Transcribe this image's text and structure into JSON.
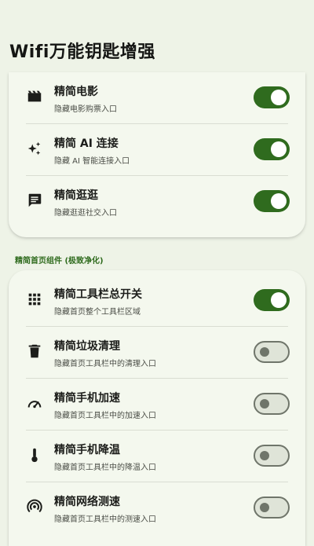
{
  "header": {
    "title": "Wifi万能钥匙增强"
  },
  "group1": [
    {
      "title": "精简电影",
      "subtitle": "隐藏电影购票入口",
      "icon": "clapperboard-icon",
      "enabled": true
    },
    {
      "title": "精简 AI 连接",
      "subtitle": "隐藏 AI 智能连接入口",
      "icon": "sparkle-icon",
      "enabled": true
    },
    {
      "title": "精简逛逛",
      "subtitle": "隐藏逛逛社交入口",
      "icon": "chat-message-icon",
      "enabled": true
    }
  ],
  "section2": {
    "label": "精简首页组件 (极致净化)"
  },
  "group2": [
    {
      "title": "精简工具栏总开关",
      "subtitle": "隐藏首页整个工具栏区域",
      "icon": "grid-dots-icon",
      "enabled": true
    },
    {
      "title": "精简垃圾清理",
      "subtitle": "隐藏首页工具栏中的清理入口",
      "icon": "trash-icon",
      "enabled": false
    },
    {
      "title": "精简手机加速",
      "subtitle": "隐藏首页工具栏中的加速入口",
      "icon": "speedometer-icon",
      "enabled": false
    },
    {
      "title": "精简手机降温",
      "subtitle": "隐藏首页工具栏中的降温入口",
      "icon": "thermometer-icon",
      "enabled": false
    },
    {
      "title": "精简网络测速",
      "subtitle": "隐藏首页工具栏中的测速入口",
      "icon": "signal-test-icon",
      "enabled": false
    }
  ],
  "colors": {
    "accent": "#2f6b1e",
    "background": "#eef3e7",
    "card": "#f4f8ee"
  }
}
